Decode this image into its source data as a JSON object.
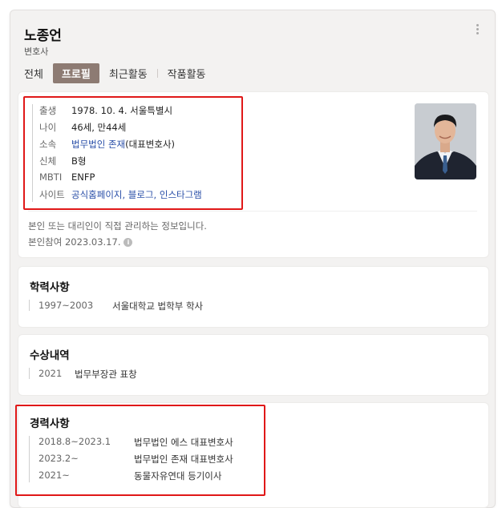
{
  "profile": {
    "name": "노종언",
    "role": "변호사"
  },
  "tabs": [
    {
      "label": "전체"
    },
    {
      "label": "프로필",
      "active": true
    },
    {
      "label": "최근활동"
    },
    {
      "label": "작품활동"
    }
  ],
  "basic_info": [
    {
      "key": "출생",
      "value": "1978. 10. 4. 서울특별시"
    },
    {
      "key": "나이",
      "value": "46세, 만44세"
    },
    {
      "key": "소속",
      "link": "법무법인 존재",
      "suffix": "(대표변호사)"
    },
    {
      "key": "신체",
      "value": "B형"
    },
    {
      "key": "MBTI",
      "value": "ENFP"
    },
    {
      "key": "사이트",
      "links": [
        "공식홈페이지",
        "블로그",
        "인스타그램"
      ]
    }
  ],
  "notice": {
    "text": "본인 또는 대리인이 직접 관리하는 정보입니다.",
    "verified": "본인참여 2023.03.17.",
    "info_icon": "i"
  },
  "education": {
    "title": "학력사항",
    "items": [
      {
        "date": "1997~2003",
        "text": "서울대학교 법학부 학사"
      }
    ]
  },
  "awards": {
    "title": "수상내역",
    "items": [
      {
        "date": "2021",
        "text": "법무부장관 표창"
      }
    ]
  },
  "career": {
    "title": "경력사항",
    "items": [
      {
        "date": "2018.8~2023.1",
        "text": "법무법인 에스 대표변호사"
      },
      {
        "date": "2023.2~",
        "text": "법무법인 존재 대표변호사"
      },
      {
        "date": "2021~",
        "text": "동물자유연대 등기이사"
      }
    ]
  },
  "colors": {
    "highlight": "#e01818",
    "link": "#2a4fa8",
    "active_tab": "#8d7b73"
  },
  "icons": {
    "more": "more-vertical-icon",
    "info": "info-circle-icon"
  }
}
